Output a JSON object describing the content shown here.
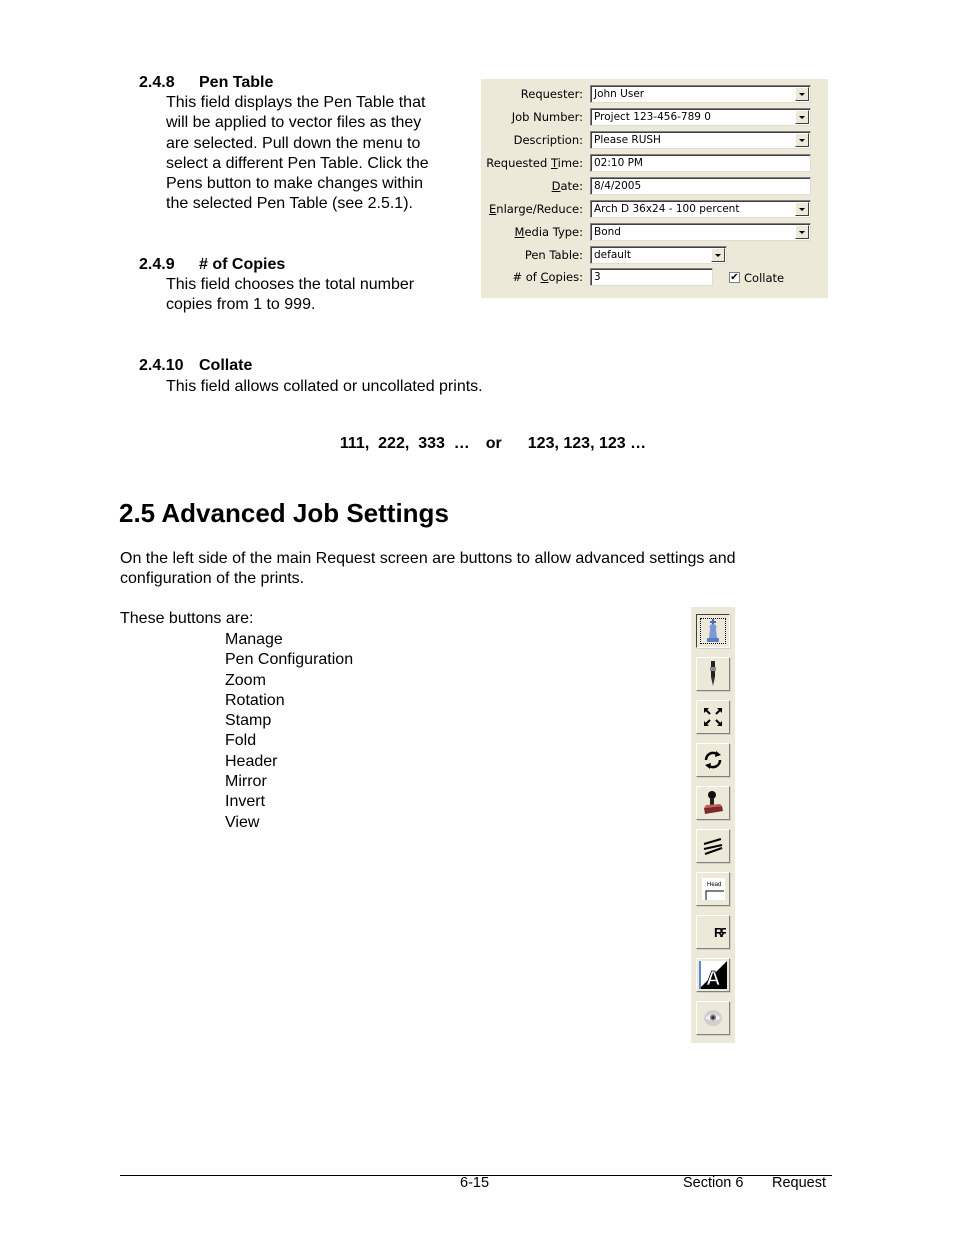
{
  "sections": {
    "pen_table": {
      "number": "2.4.8",
      "title": "Pen Table",
      "lines": [
        "This field displays the Pen Table that",
        "will be applied to vector files as they",
        "are selected.  Pull down the menu to",
        "select a different Pen Table.  Click the",
        "Pens button to make changes within",
        "the selected Pen Table (see 2.5.1)."
      ]
    },
    "copies": {
      "number": "2.4.9",
      "title": "# of Copies",
      "lines": [
        "This field chooses the total number",
        "copies from 1 to 999."
      ]
    },
    "collate": {
      "number": "2.4.10",
      "title": "Collate",
      "text": "This field allows collated or uncollated prints.",
      "example_uncollated": "111,  222,  333  …",
      "example_or": "or",
      "example_collated": "123, 123, 123 …"
    },
    "advanced": {
      "heading": "2.5  Advanced Job Settings",
      "intro_lines": [
        "On the left side of the main Request screen are buttons to allow advanced settings and",
        "configuration of the prints."
      ],
      "list_intro": "These buttons are:",
      "buttons": [
        "Manage",
        "Pen Configuration",
        "Zoom",
        "Rotation",
        "Stamp",
        "Fold",
        "Header",
        "Mirror",
        "Invert",
        "View"
      ]
    }
  },
  "form": {
    "requester": {
      "label": "Requester:",
      "value": "John User"
    },
    "job_number": {
      "label": "Job Number:",
      "value": "Project 123-456-789 0"
    },
    "description": {
      "label": "Description:",
      "value": "Please RUSH"
    },
    "requested_time": {
      "label_pre": "Requested ",
      "label_u": "T",
      "label_post": "ime:",
      "value": "02:10 PM"
    },
    "date": {
      "label_pre": "",
      "label_u": "D",
      "label_post": "ate:",
      "value": "8/4/2005"
    },
    "enlarge_reduce": {
      "label_pre": "",
      "label_u": "E",
      "label_post": "nlarge/Reduce:",
      "value": "Arch D 36x24 - 100 percent"
    },
    "media_type": {
      "label_pre": "",
      "label_u": "M",
      "label_post": "edia Type:",
      "value": "Bond"
    },
    "pen_table": {
      "label": "Pen Table:",
      "value": "default"
    },
    "copies": {
      "label_pre": "# of ",
      "label_u": "C",
      "label_post": "opies:",
      "value": "3"
    },
    "collate": {
      "label": "Collate",
      "checked": true,
      "check_glyph": "✔"
    }
  },
  "footer": {
    "page": "6-15",
    "section": "Section 6",
    "chapter": "Request"
  }
}
